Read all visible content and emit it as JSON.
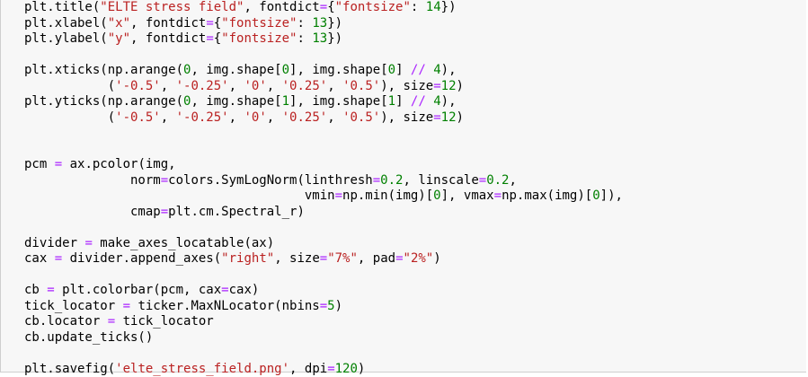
{
  "editor": {
    "lines": [
      [
        {
          "t": "plt.title(",
          "k": "t"
        },
        {
          "t": "\"ELTE stress field\"",
          "k": "s"
        },
        {
          "t": ", fontdict",
          "k": "t"
        },
        {
          "t": "=",
          "k": "o"
        },
        {
          "t": "{",
          "k": "t"
        },
        {
          "t": "\"fontsize\"",
          "k": "s"
        },
        {
          "t": ": ",
          "k": "t"
        },
        {
          "t": "14",
          "k": "n"
        },
        {
          "t": "})",
          "k": "t"
        }
      ],
      [
        {
          "t": "plt.xlabel(",
          "k": "t"
        },
        {
          "t": "\"x\"",
          "k": "s"
        },
        {
          "t": ", fontdict",
          "k": "t"
        },
        {
          "t": "=",
          "k": "o"
        },
        {
          "t": "{",
          "k": "t"
        },
        {
          "t": "\"fontsize\"",
          "k": "s"
        },
        {
          "t": ": ",
          "k": "t"
        },
        {
          "t": "13",
          "k": "n"
        },
        {
          "t": "})",
          "k": "t"
        }
      ],
      [
        {
          "t": "plt.ylabel(",
          "k": "t"
        },
        {
          "t": "\"y\"",
          "k": "s"
        },
        {
          "t": ", fontdict",
          "k": "t"
        },
        {
          "t": "=",
          "k": "o"
        },
        {
          "t": "{",
          "k": "t"
        },
        {
          "t": "\"fontsize\"",
          "k": "s"
        },
        {
          "t": ": ",
          "k": "t"
        },
        {
          "t": "13",
          "k": "n"
        },
        {
          "t": "})",
          "k": "t"
        }
      ],
      [],
      [
        {
          "t": "plt.xticks(np.arange(",
          "k": "t"
        },
        {
          "t": "0",
          "k": "n"
        },
        {
          "t": ", img.shape[",
          "k": "t"
        },
        {
          "t": "0",
          "k": "n"
        },
        {
          "t": "], img.shape[",
          "k": "t"
        },
        {
          "t": "0",
          "k": "n"
        },
        {
          "t": "] ",
          "k": "t"
        },
        {
          "t": "//",
          "k": "o"
        },
        {
          "t": " ",
          "k": "t"
        },
        {
          "t": "4",
          "k": "n"
        },
        {
          "t": "),",
          "k": "t"
        }
      ],
      [
        {
          "t": "           (",
          "k": "t"
        },
        {
          "t": "'-0.5'",
          "k": "s"
        },
        {
          "t": ", ",
          "k": "t"
        },
        {
          "t": "'-0.25'",
          "k": "s"
        },
        {
          "t": ", ",
          "k": "t"
        },
        {
          "t": "'0'",
          "k": "s"
        },
        {
          "t": ", ",
          "k": "t"
        },
        {
          "t": "'0.25'",
          "k": "s"
        },
        {
          "t": ", ",
          "k": "t"
        },
        {
          "t": "'0.5'",
          "k": "s"
        },
        {
          "t": "), size",
          "k": "t"
        },
        {
          "t": "=",
          "k": "o"
        },
        {
          "t": "12",
          "k": "n"
        },
        {
          "t": ")",
          "k": "t"
        }
      ],
      [
        {
          "t": "plt.yticks(np.arange(",
          "k": "t"
        },
        {
          "t": "0",
          "k": "n"
        },
        {
          "t": ", img.shape[",
          "k": "t"
        },
        {
          "t": "1",
          "k": "n"
        },
        {
          "t": "], img.shape[",
          "k": "t"
        },
        {
          "t": "1",
          "k": "n"
        },
        {
          "t": "] ",
          "k": "t"
        },
        {
          "t": "//",
          "k": "o"
        },
        {
          "t": " ",
          "k": "t"
        },
        {
          "t": "4",
          "k": "n"
        },
        {
          "t": "),",
          "k": "t"
        }
      ],
      [
        {
          "t": "           (",
          "k": "t"
        },
        {
          "t": "'-0.5'",
          "k": "s"
        },
        {
          "t": ", ",
          "k": "t"
        },
        {
          "t": "'-0.25'",
          "k": "s"
        },
        {
          "t": ", ",
          "k": "t"
        },
        {
          "t": "'0'",
          "k": "s"
        },
        {
          "t": ", ",
          "k": "t"
        },
        {
          "t": "'0.25'",
          "k": "s"
        },
        {
          "t": ", ",
          "k": "t"
        },
        {
          "t": "'0.5'",
          "k": "s"
        },
        {
          "t": "), size",
          "k": "t"
        },
        {
          "t": "=",
          "k": "o"
        },
        {
          "t": "12",
          "k": "n"
        },
        {
          "t": ")",
          "k": "t"
        }
      ],
      [],
      [],
      [
        {
          "t": "pcm ",
          "k": "t"
        },
        {
          "t": "=",
          "k": "o"
        },
        {
          "t": " ax.pcolor(img,",
          "k": "t"
        }
      ],
      [
        {
          "t": "              norm",
          "k": "t"
        },
        {
          "t": "=",
          "k": "o"
        },
        {
          "t": "colors.SymLogNorm(linthresh",
          "k": "t"
        },
        {
          "t": "=",
          "k": "o"
        },
        {
          "t": "0.2",
          "k": "n"
        },
        {
          "t": ", linscale",
          "k": "t"
        },
        {
          "t": "=",
          "k": "o"
        },
        {
          "t": "0.2",
          "k": "n"
        },
        {
          "t": ",",
          "k": "t"
        }
      ],
      [
        {
          "t": "                                     vmin",
          "k": "t"
        },
        {
          "t": "=",
          "k": "o"
        },
        {
          "t": "np.min(img)[",
          "k": "t"
        },
        {
          "t": "0",
          "k": "n"
        },
        {
          "t": "], vmax",
          "k": "t"
        },
        {
          "t": "=",
          "k": "o"
        },
        {
          "t": "np.max(img)[",
          "k": "t"
        },
        {
          "t": "0",
          "k": "n"
        },
        {
          "t": "]),",
          "k": "t"
        }
      ],
      [
        {
          "t": "              cmap",
          "k": "t"
        },
        {
          "t": "=",
          "k": "o"
        },
        {
          "t": "plt.cm.Spectral_r)",
          "k": "t"
        }
      ],
      [],
      [
        {
          "t": "divider ",
          "k": "t"
        },
        {
          "t": "=",
          "k": "o"
        },
        {
          "t": " make_axes_locatable(ax)",
          "k": "t"
        }
      ],
      [
        {
          "t": "cax ",
          "k": "t"
        },
        {
          "t": "=",
          "k": "o"
        },
        {
          "t": " divider.append_axes(",
          "k": "t"
        },
        {
          "t": "\"right\"",
          "k": "s"
        },
        {
          "t": ", size",
          "k": "t"
        },
        {
          "t": "=",
          "k": "o"
        },
        {
          "t": "\"7%\"",
          "k": "s"
        },
        {
          "t": ", pad",
          "k": "t"
        },
        {
          "t": "=",
          "k": "o"
        },
        {
          "t": "\"2%\"",
          "k": "s"
        },
        {
          "t": ")",
          "k": "t"
        }
      ],
      [],
      [
        {
          "t": "cb ",
          "k": "t"
        },
        {
          "t": "=",
          "k": "o"
        },
        {
          "t": " plt.colorbar(pcm, cax",
          "k": "t"
        },
        {
          "t": "=",
          "k": "o"
        },
        {
          "t": "cax)",
          "k": "t"
        }
      ],
      [
        {
          "t": "tick_locator ",
          "k": "t"
        },
        {
          "t": "=",
          "k": "o"
        },
        {
          "t": " ticker.MaxNLocator(nbins",
          "k": "t"
        },
        {
          "t": "=",
          "k": "o"
        },
        {
          "t": "5",
          "k": "n"
        },
        {
          "t": ")",
          "k": "t"
        }
      ],
      [
        {
          "t": "cb.locator ",
          "k": "t"
        },
        {
          "t": "=",
          "k": "o"
        },
        {
          "t": " tick_locator",
          "k": "t"
        }
      ],
      [
        {
          "t": "cb.update_ticks()",
          "k": "t"
        }
      ],
      [],
      [
        {
          "t": "plt.savefig(",
          "k": "t"
        },
        {
          "t": "'elte_stress_field.png'",
          "k": "s"
        },
        {
          "t": ", dpi",
          "k": "t"
        },
        {
          "t": "=",
          "k": "o"
        },
        {
          "t": "120",
          "k": "n"
        },
        {
          "t": ")",
          "k": "t"
        }
      ]
    ]
  },
  "colors": {
    "background": "#f7f7f7",
    "string": "#ba2121",
    "number": "#008000",
    "operator": "#aa22ff",
    "text": "#000000"
  }
}
